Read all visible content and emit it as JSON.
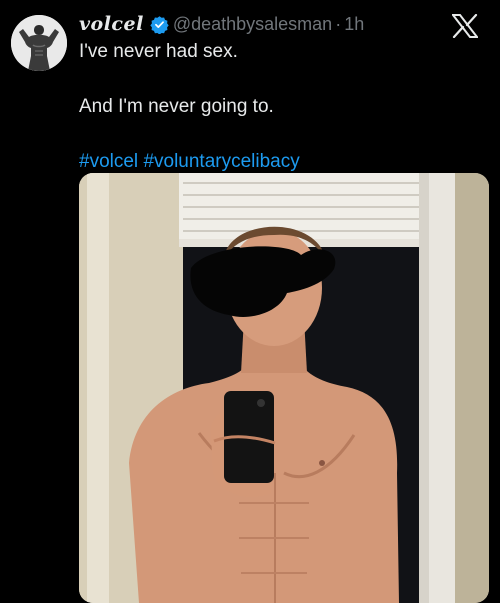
{
  "tweet": {
    "display_name": "volcel",
    "handle": "@deathbysalesman",
    "separator": "·",
    "time": "1h",
    "lines": [
      "I've never had sex.",
      "And I'm never going to."
    ],
    "hashtags": [
      "#volcel",
      "#voluntarycelibacy"
    ]
  },
  "icons": {
    "verified": "verified-badge-icon",
    "x": "x-logo-icon"
  },
  "colors": {
    "background": "#000000",
    "text": "#e7e9ea",
    "muted": "#71767b",
    "link": "#1d9bf0",
    "verified": "#1d9bf0"
  }
}
